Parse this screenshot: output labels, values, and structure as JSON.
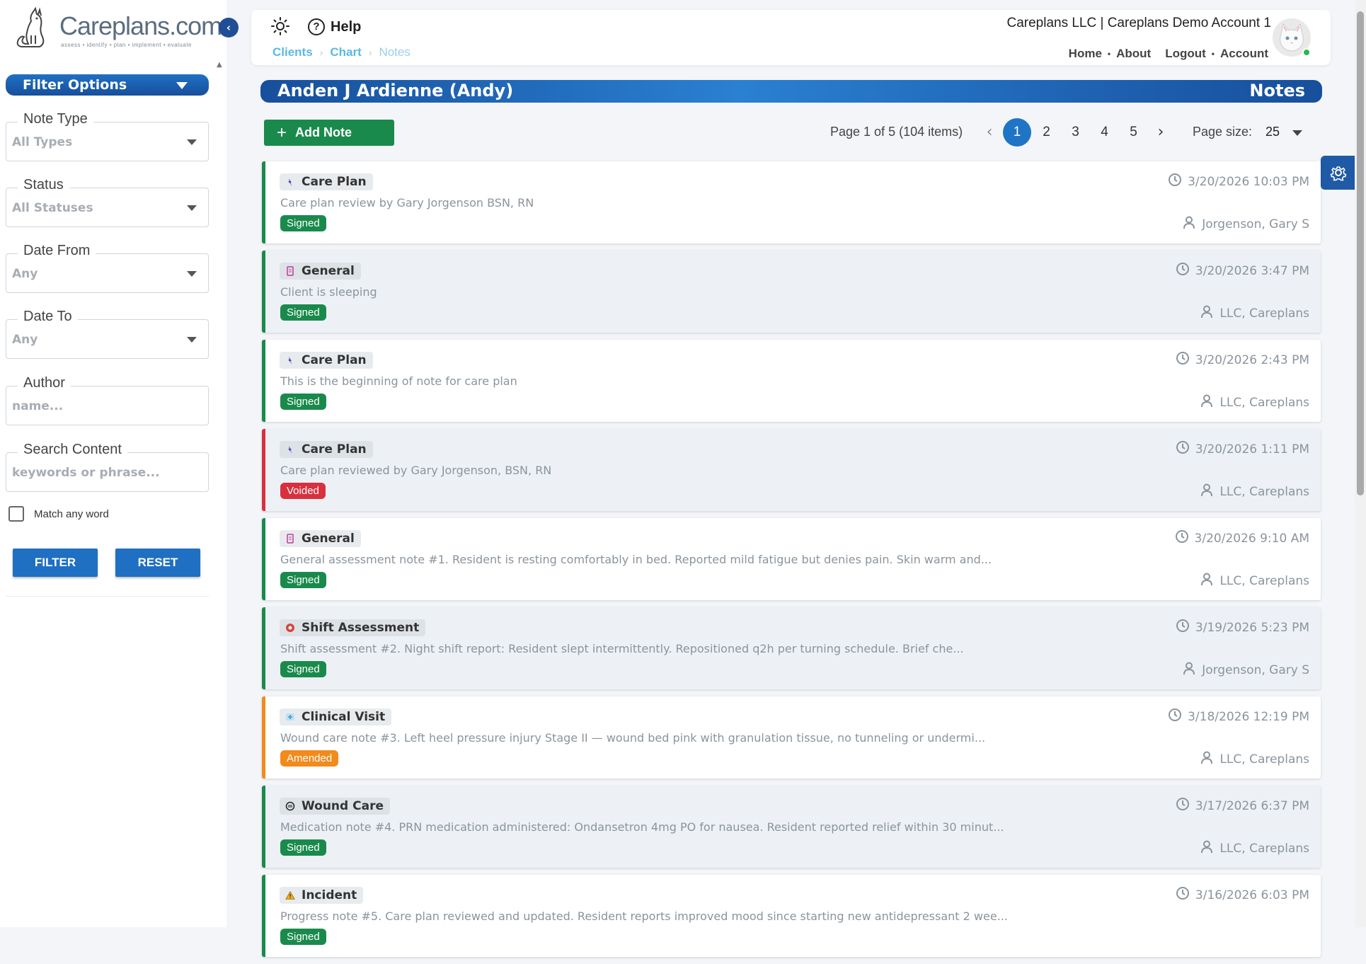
{
  "app": {
    "logo_text": "Careplans.com",
    "logo_tagline": "assess • identify • plan • implement • evaluate"
  },
  "sidebar": {
    "filter_header": "Filter Options",
    "fields": {
      "note_type": {
        "label": "Note Type",
        "value": "All Types"
      },
      "status": {
        "label": "Status",
        "value": "All Statuses"
      },
      "date_from": {
        "label": "Date From",
        "value": "Any"
      },
      "date_to": {
        "label": "Date To",
        "value": "Any"
      },
      "author": {
        "label": "Author",
        "placeholder": "name..."
      },
      "search": {
        "label": "Search Content",
        "placeholder": "keywords or phrase..."
      }
    },
    "match_any_label": "Match any word",
    "match_any_checked": false,
    "filter_button": "FILTER",
    "reset_button": "RESET"
  },
  "header": {
    "help_label": "Help",
    "breadcrumb": [
      "Clients",
      "Chart",
      "Notes"
    ],
    "account_name": "Careplans LLC | Careplans Demo Account 1",
    "nav": [
      "Home",
      "About",
      "Logout",
      "Account"
    ]
  },
  "banner": {
    "patient_name": "Anden J Ardienne (Andy)",
    "section": "Notes"
  },
  "toolbar": {
    "add_note_label": "Add Note",
    "page_info": "Page 1 of 5 (104 items)",
    "pages": [
      "1",
      "2",
      "3",
      "4",
      "5"
    ],
    "current_page": "1",
    "page_size_label": "Page size:",
    "page_size": "25"
  },
  "colors": {
    "signed": "#1a8a4c",
    "voided": "#d8303f",
    "amended": "#f28a1c",
    "brand_blue": "#1f5aa6"
  },
  "notes": [
    {
      "type": "Care Plan",
      "icon": "lightning-icon",
      "summary": "Care plan review by Gary Jorgenson BSN, RN",
      "status": "Signed",
      "date": "3/20/2026 10:03 PM",
      "author": "Jorgenson, Gary S"
    },
    {
      "type": "General",
      "icon": "document-icon",
      "summary": "Client is sleeping",
      "status": "Signed",
      "date": "3/20/2026 3:47 PM",
      "author": "LLC, Careplans"
    },
    {
      "type": "Care Plan",
      "icon": "lightning-icon",
      "summary": "This is the beginning of note for care plan",
      "status": "Signed",
      "date": "3/20/2026 2:43 PM",
      "author": "LLC, Careplans"
    },
    {
      "type": "Care Plan",
      "icon": "lightning-icon",
      "summary": "Care plan reviewed by Gary Jorgenson, BSN, RN",
      "status": "Voided",
      "date": "3/20/2026 1:11 PM",
      "author": "LLC, Careplans"
    },
    {
      "type": "General",
      "icon": "document-icon",
      "summary": "General assessment note #1. Resident is resting comfortably in bed. Reported mild fatigue but denies pain. Skin warm and...",
      "status": "Signed",
      "date": "3/20/2026 9:10 AM",
      "author": "LLC, Careplans"
    },
    {
      "type": "Shift Assessment",
      "icon": "lifebuoy-icon",
      "summary": "Shift assessment #2. Night shift report: Resident slept intermittently. Repositioned q2h per turning schedule. Brief che...",
      "status": "Signed",
      "date": "3/19/2026 5:23 PM",
      "author": "Jorgenson, Gary S"
    },
    {
      "type": "Clinical Visit",
      "icon": "medical-icon",
      "summary": "Wound care note #3. Left heel pressure injury Stage II — wound bed pink with granulation tissue, no tunneling or undermi...",
      "status": "Amended",
      "date": "3/18/2026 12:19 PM",
      "author": "LLC, Careplans"
    },
    {
      "type": "Wound Care",
      "icon": "bandage-icon",
      "summary": "Medication note #4. PRN medication administered: Ondansetron 4mg PO for nausea. Resident reported relief within 30 minut...",
      "status": "Signed",
      "date": "3/17/2026 6:37 PM",
      "author": "LLC, Careplans"
    },
    {
      "type": "Incident",
      "icon": "warning-icon",
      "summary": "Progress note #5. Care plan reviewed and updated. Resident reports improved mood since starting new antidepressant 2 wee...",
      "status": "Signed",
      "date": "3/16/2026 6:03 PM",
      "author": ""
    }
  ]
}
